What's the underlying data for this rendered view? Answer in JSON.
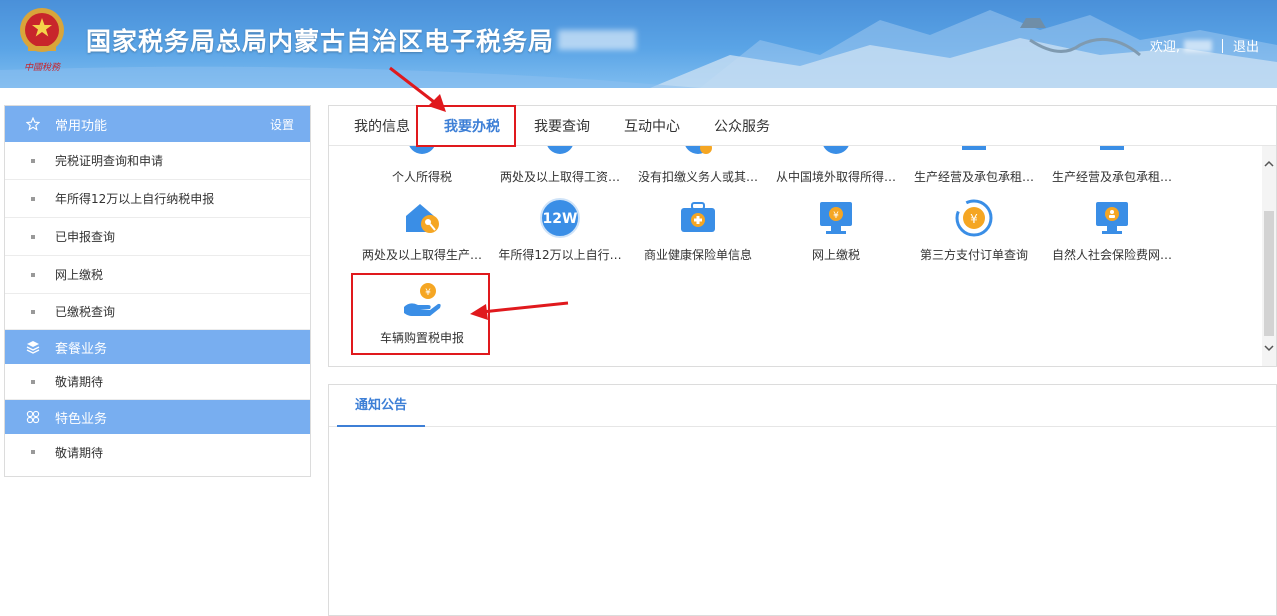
{
  "header": {
    "site_title": "国家税务局总局内蒙古自治区电子税务局",
    "welcome": "欢迎,",
    "logout": "退出"
  },
  "sidebar": {
    "section_common": {
      "title": "常用功能",
      "setting": "设置"
    },
    "common_items": [
      {
        "label": "完税证明查询和申请"
      },
      {
        "label": "年所得12万以上自行纳税申报"
      },
      {
        "label": "已申报查询"
      },
      {
        "label": "网上缴税"
      },
      {
        "label": "已缴税查询"
      }
    ],
    "section_package": {
      "title": "套餐业务"
    },
    "package_items": [
      {
        "label": "敬请期待"
      }
    ],
    "section_special": {
      "title": "特色业务"
    },
    "special_items": [
      {
        "label": "敬请期待"
      }
    ]
  },
  "main": {
    "tabs": [
      {
        "label": "我的信息"
      },
      {
        "label": "我要办税"
      },
      {
        "label": "我要查询"
      },
      {
        "label": "互动中心"
      },
      {
        "label": "公众服务"
      }
    ],
    "active_tab": "我要办税",
    "grid_row1": [
      {
        "label": "个人所得税"
      },
      {
        "label": "两处及以上取得工资…"
      },
      {
        "label": "没有扣缴义务人或其…"
      },
      {
        "label": "从中国境外取得所得…"
      },
      {
        "label": "生产经营及承包承租…"
      },
      {
        "label": "生产经营及承包承租…"
      }
    ],
    "grid_row2": [
      {
        "label": "两处及以上取得生产…",
        "icon": "house-key-icon"
      },
      {
        "label": "年所得12万以上自行…",
        "icon": "12w-icon",
        "badge": "12W"
      },
      {
        "label": "商业健康保险单信息",
        "icon": "medical-kit-icon"
      },
      {
        "label": "网上缴税",
        "icon": "monitor-yen-icon"
      },
      {
        "label": "第三方支付订单查询",
        "icon": "yen-shield-icon"
      },
      {
        "label": "自然人社会保险费网…",
        "icon": "monitor-social-icon"
      }
    ],
    "grid_row3": [
      {
        "label": "车辆购置税申报",
        "icon": "hand-coin-icon"
      }
    ]
  },
  "notice": {
    "tab_label": "通知公告"
  },
  "colors": {
    "accent": "#3d7fd6",
    "sidebar_header": "#78aef0",
    "highlight": "#e0191d",
    "icon_blue": "#3a8ee6",
    "icon_orange": "#f5a623"
  }
}
